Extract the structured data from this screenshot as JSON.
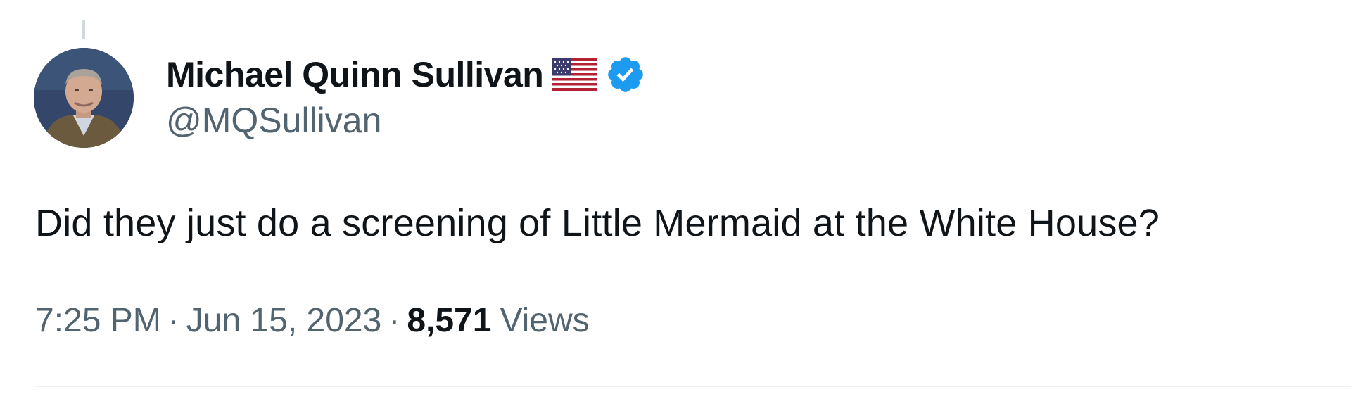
{
  "tweet": {
    "author": {
      "display_name": "Michael Quinn Sullivan",
      "handle": "@MQSullivan",
      "flag_icon": "us-flag-icon",
      "verified_icon": "verified-badge-icon",
      "verified_color": "#1d9bf0"
    },
    "text": "Did they just do a screening of Little Mermaid at the White House?",
    "meta": {
      "time": "7:25 PM",
      "separator": "·",
      "date": "Jun 15, 2023",
      "views_count": "8,571",
      "views_label": "Views"
    }
  }
}
